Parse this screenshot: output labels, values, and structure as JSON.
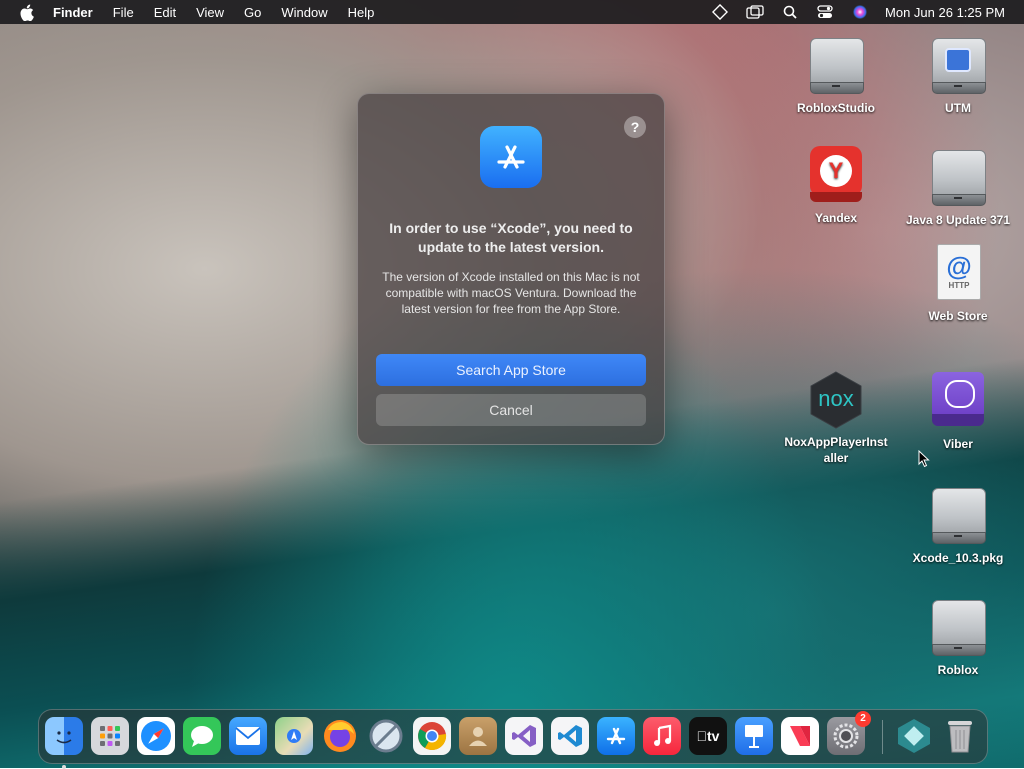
{
  "menubar": {
    "app_name": "Finder",
    "menus": [
      "File",
      "Edit",
      "View",
      "Go",
      "Window",
      "Help"
    ],
    "clock": "Mon Jun 26  1:25 PM",
    "status_icons": [
      "diamond-icon",
      "windows-icon",
      "search-icon",
      "control-center-icon",
      "siri-icon"
    ]
  },
  "desktop": {
    "icons": [
      {
        "label": "RobloxStudio",
        "icon": "disk-icon"
      },
      {
        "label": "UTM",
        "icon": "utm-icon"
      },
      {
        "label": "Yandex",
        "icon": "yandex-icon"
      },
      {
        "label": "Java 8 Update 371",
        "icon": "disk-icon"
      },
      {
        "label": "Web Store",
        "icon": "web-store-icon"
      },
      {
        "label": "NoxAppPlayerInstaller",
        "icon": "nox-icon"
      },
      {
        "label": "Viber",
        "icon": "viber-icon"
      },
      {
        "label": "Xcode_10.3.pkg",
        "icon": "disk-icon"
      },
      {
        "label": "Roblox",
        "icon": "disk-icon"
      }
    ],
    "nox_label_line1": "NoxAppPlayerInst",
    "nox_label_line2": "aller",
    "web_store_glyph": "@",
    "web_store_caption": "HTTP",
    "nox_logo_text": "nox"
  },
  "dialog": {
    "title": "In order to use “Xcode”, you need to update to the latest version.",
    "message": "The version of Xcode installed on this Mac is not compatible with macOS Ventura. Download the latest version for free from the App Store.",
    "primary_button": "Search App Store",
    "secondary_button": "Cancel",
    "help": "?"
  },
  "dock": {
    "items": [
      {
        "name": "Finder",
        "icon": "finder-icon",
        "color": "#3a8cf0"
      },
      {
        "name": "Launchpad",
        "icon": "launchpad-icon",
        "color": "#9aa0a6"
      },
      {
        "name": "Safari",
        "icon": "safari-icon",
        "color": "#1e90ff"
      },
      {
        "name": "Messages",
        "icon": "messages-icon",
        "color": "#34c759"
      },
      {
        "name": "Mail",
        "icon": "mail-icon",
        "color": "#2f8ff7"
      },
      {
        "name": "Maps",
        "icon": "maps-icon",
        "color": "#5fbf6b"
      },
      {
        "name": "Firefox",
        "icon": "firefox-icon",
        "color": "#ff6a2a"
      },
      {
        "name": "Network Radar",
        "icon": "no-entry-icon",
        "color": "#7c8b9a"
      },
      {
        "name": "Chrome",
        "icon": "chrome-icon",
        "color": "#f4f4f4"
      },
      {
        "name": "Contacts",
        "icon": "contacts-icon",
        "color": "#b58c55"
      },
      {
        "name": "Visual Studio",
        "icon": "visual-studio-icon",
        "color": "#f2f2f2"
      },
      {
        "name": "VS Code",
        "icon": "vscode-icon",
        "color": "#f2f2f2"
      },
      {
        "name": "App Store",
        "icon": "app-store-icon",
        "color": "#1e88f5"
      },
      {
        "name": "Music",
        "icon": "music-icon",
        "color": "#fc3c44"
      },
      {
        "name": "TV",
        "icon": "tv-icon",
        "color": "#111111"
      },
      {
        "name": "Keynote",
        "icon": "keynote-icon",
        "color": "#2f86f6"
      },
      {
        "name": "News",
        "icon": "news-icon",
        "color": "#f5f5f5"
      },
      {
        "name": "System Settings",
        "icon": "settings-icon",
        "color": "#8e8e93",
        "badge": "2"
      },
      {
        "name": "Nox",
        "icon": "nox-dock-icon",
        "color": "#2c7f84"
      },
      {
        "name": "Trash",
        "icon": "trash-icon",
        "color": "#c9c9c9"
      }
    ],
    "tv_label": "tv"
  }
}
